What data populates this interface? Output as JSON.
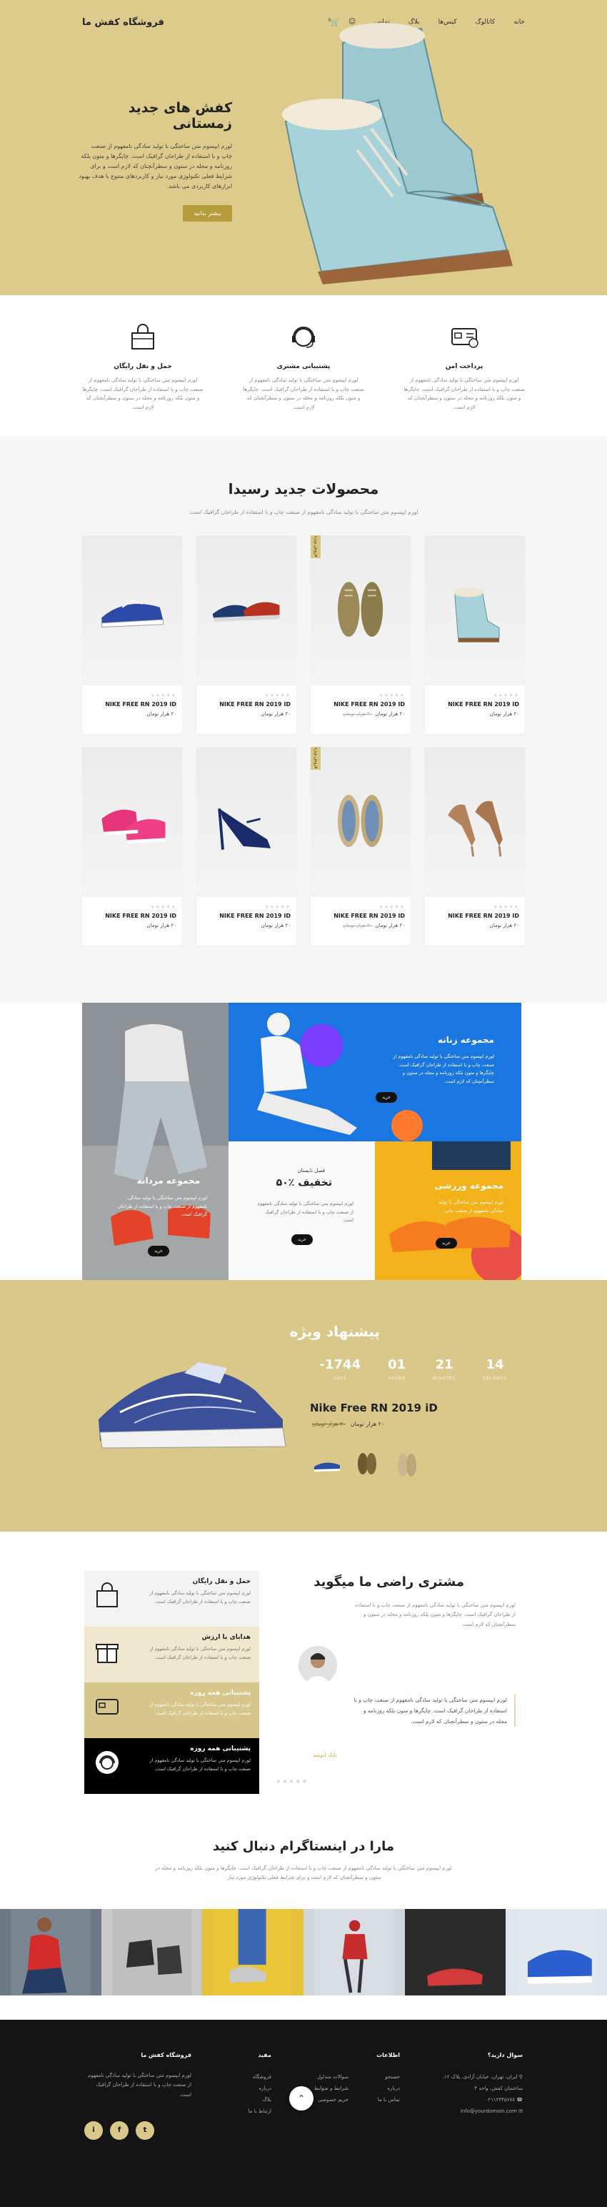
{
  "header": {
    "logo": "فروشگاه کفش ما",
    "menu": [
      "خانه",
      "کاتالوگ",
      "کیس‌ها",
      "بلاگ",
      "تماس"
    ],
    "cart_count": "0"
  },
  "hero": {
    "title": "کفش های جدید زمستانی",
    "description": "لورم ایپسوم متن ساختگی با تولید سادگی نامفهوم از صنعت چاپ و با استفاده از طراحان گرافیک است. چاپگرها و متون بلکه روزنامه و مجله در ستون و سطرآنچنان که لازم است و برای شرایط فعلی تکنولوژی مورد نیاز و کاربردهای متنوع با هدف بهبود ابزارهای کاربردی می باشد.",
    "button": "بیشتر بدانید"
  },
  "features": [
    {
      "title": "حمل و نقل رایگان",
      "desc": "لورم ایپسوم متن ساختگی با تولید سادگی نامفهوم از صنعت چاپ و با استفاده از طراحان گرافیک است. چاپگرها و متون بلکه روزنامه و مجله در ستون و سطرآنچنان که لازم است."
    },
    {
      "title": "پشتیبانی مشتری",
      "desc": "لورم ایپسوم متن ساختگی با تولید سادگی نامفهوم از صنعت چاپ و با استفاده از طراحان گرافیک است. چاپگرها و متون بلکه روزنامه و مجله در ستون و سطرآنچنان که لازم است."
    },
    {
      "title": "پرداخت امن",
      "desc": "لورم ایپسوم متن ساختگی با تولید سادگی نامفهوم از صنعت چاپ و با استفاده از طراحان گرافیک است. چاپگرها و متون بلکه روزنامه و مجله در ستون و سطرآنچنان که لازم است."
    }
  ],
  "products": {
    "title": "محصولات جدید رسیدا",
    "subtitle": "لورم ایپسوم متن ساختگی با تولید سادگی نامفهوم از صنعت چاپ و با استفاده از طراحان گرافیک است.",
    "items": [
      {
        "name": "NIKE FREE RN 2019 ID",
        "price": "۲۰ هزار تومان",
        "old_price": "",
        "tag": ""
      },
      {
        "name": "NIKE FREE RN 2019 ID",
        "price": "۲۰ هزار تومان",
        "old_price": "۳۰ هزار تومان",
        "tag": "فروش ویژه"
      },
      {
        "name": "NIKE FREE RN 2019 ID",
        "price": "۲۰ هزار تومان",
        "old_price": "",
        "tag": ""
      },
      {
        "name": "NIKE FREE RN 2019 ID",
        "price": "۲۰ هزار تومان",
        "old_price": "",
        "tag": ""
      },
      {
        "name": "NIKE FREE RN 2019 ID",
        "price": "۲۰ هزار تومان",
        "old_price": "",
        "tag": ""
      },
      {
        "name": "NIKE FREE RN 2019 ID",
        "price": "۲۰ هزار تومان",
        "old_price": "۳۰ هزار تومان",
        "tag": "فروش ویژه"
      },
      {
        "name": "NIKE FREE RN 2019 ID",
        "price": "۲۰ هزار تومان",
        "old_price": "",
        "tag": ""
      },
      {
        "name": "NIKE FREE RN 2019 ID",
        "price": "۲۰ هزار تومان",
        "old_price": "",
        "tag": ""
      }
    ]
  },
  "collections": {
    "women": {
      "title": "مجموعه زنانه",
      "desc": "لورم ایپسوم متن ساختگی با تولید سادگی نامفهوم از صنعت چاپ و با استفاده از طراحان گرافیک است. چاپگرها و متون بلکه روزنامه و مجله در ستون و سطرآنچنان که لازم است.",
      "button": "خرید"
    },
    "men": {
      "title": "مجموعه مردانه",
      "desc": "لورم ایپسوم متن ساختگی با تولید سادگی نامفهوم از صنعت چاپ و با استفاده از طراحان گرافیک است.",
      "button": "خرید"
    },
    "discount": {
      "kicker": "فصل تابستان",
      "title": "۵۰٪ تخفیف",
      "desc": "لورم ایپسوم متن ساختگی با تولید سادگی نامفهوم از صنعت چاپ و با استفاده از طراحان گرافیک است.",
      "button": "خرید"
    },
    "sport": {
      "title": "مجموعه ورزشی",
      "desc": "لورم ایپسوم متن ساختگی با تولید سادگی نامفهوم از صنعت چاپ.",
      "button": "خرید"
    }
  },
  "offer": {
    "title": "پیشنهاد ویژه",
    "countdown": [
      {
        "value": "-1744",
        "label": "DAYS"
      },
      {
        "value": "01",
        "label": "HOURS"
      },
      {
        "value": "21",
        "label": "MINUTES"
      },
      {
        "value": "14",
        "label": "SECONDS"
      }
    ],
    "product_name": "Nike Free RN 2019 iD",
    "price": "۲۰ هزار تومان",
    "old_price": "۳۰ هزار تومان"
  },
  "testimonial": {
    "title": "مشتری راضی ما میگوید",
    "desc": "لورم ایپسوم متن ساختگی با تولید سادگی نامفهوم از صنعت چاپ و با استفاده از طراحان گرافیک است. چاپگرها و متون بلکه روزنامه و مجله در ستون و سطرآنچنان که لازم است.",
    "quote": "لورم ایپسوم متن ساختگی با تولید سادگی نامفهوم از صنعت چاپ و با استفاده از طراحان گرافیک است. چاپگرها و متون بلکه روزنامه و مجله در ستون و سطرآنچنان که لازم است.",
    "name": "بابک انوشه",
    "panel": [
      {
        "title": "حمل و نقل رایگان",
        "desc": "لورم ایپسوم متن ساختگی با تولید سادگی نامفهوم از صنعت چاپ و با استفاده از طراحان گرافیک است."
      },
      {
        "title": "هدایای با ارزش",
        "desc": "لورم ایپسوم متن ساختگی با تولید سادگی نامفهوم از صنعت چاپ و با استفاده از طراحان گرافیک است."
      },
      {
        "title": "پشتیبانی همه روزه",
        "desc": "لورم ایپسوم متن ساختگی با تولید سادگی نامفهوم از صنعت چاپ و با استفاده از طراحان گرافیک است."
      },
      {
        "title": "پشتیبانی همه روزه",
        "desc": "لورم ایپسوم متن ساختگی با تولید سادگی نامفهوم از صنعت چاپ و با استفاده از طراحان گرافیک است."
      }
    ]
  },
  "instagram": {
    "title": "مارا در اینستاگرام دنبال کنید",
    "desc": "لورم ایپسوم متن ساختگی با تولید سادگی نامفهوم از صنعت چاپ و با استفاده از طراحان گرافیک است. چاپگرها و متون بلکه روزنامه و مجله در ستون و سطرآنچنان که لازم است و برای شرایط فعلی تکنولوژی مورد نیاز."
  },
  "footer": {
    "contact_title": "سوال دارید؟",
    "address": "ایران، تهران، خیابان آزادی، پلاک ۱۲، ساختمان کفش، واحد ۴",
    "phone": "۰۲۱۱۲۳۴۵۶۷۸",
    "email": "info@yourdomain.com",
    "links_title": "اطلاعات",
    "links": [
      "جستجو",
      "درباره",
      "تماس با ما",
      "سوالات متداول",
      "شرایط و ضوابط",
      "حریم خصوصی"
    ],
    "help_title": "مفید",
    "help": [
      "فروشگاه",
      "درباره",
      "بلاگ",
      "ارتباط با ما"
    ],
    "about_title": "فروشگاه کفش ما",
    "about": "لورم ایپسوم متن ساختگی با تولید سادگی نامفهوم از صنعت چاپ و با استفاده از طراحان گرافیک است.",
    "social": [
      "t",
      "f",
      "i"
    ]
  }
}
